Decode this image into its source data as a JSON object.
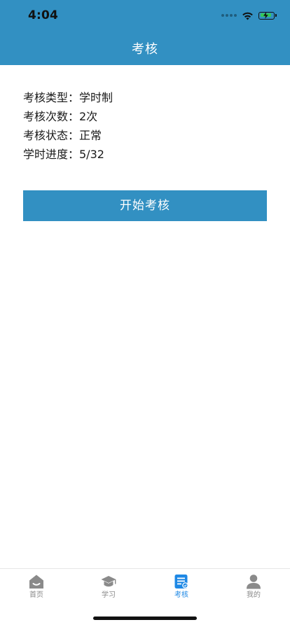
{
  "status_bar": {
    "time": "4:04"
  },
  "nav": {
    "title": "考核"
  },
  "info": {
    "rows": [
      "考核类型：学时制",
      "考核次数：2次",
      "考核状态：正常",
      "学时进度：5/32"
    ]
  },
  "action": {
    "start_label": "开始考核"
  },
  "tabbar": {
    "tabs": [
      {
        "label": "首页",
        "icon": "home-icon"
      },
      {
        "label": "学习",
        "icon": "graduation-cap-icon"
      },
      {
        "label": "考核",
        "icon": "exam-icon"
      },
      {
        "label": "我的",
        "icon": "user-icon"
      }
    ],
    "active_index": 2
  },
  "colors": {
    "primary": "#3290c2",
    "tab_active": "#1e88e5",
    "tab_inactive": "#8a8a8a",
    "battery": "#34c759"
  }
}
